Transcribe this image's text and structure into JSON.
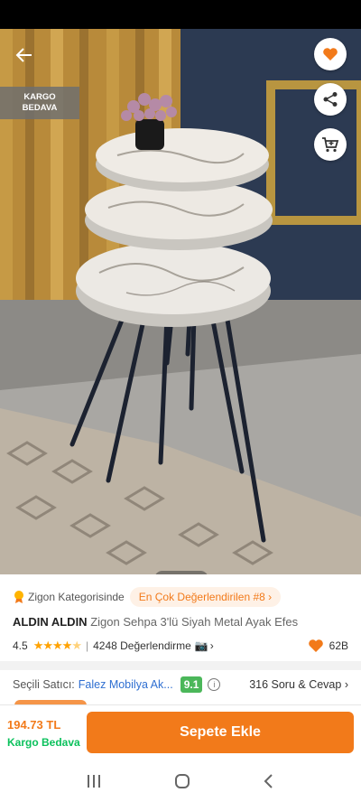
{
  "badge": {
    "line1": "KARGO",
    "line2": "BEDAVA"
  },
  "carousel": {
    "total": 3,
    "active": 0
  },
  "category": {
    "label": "Zigon Kategorisinde",
    "pill": "En Çok Değerlendirilen #8"
  },
  "product": {
    "brand": "ALDIN ALDIN",
    "name": "Zigon Sehpa 3'lü Siyah Metal Ayak Efes"
  },
  "rating": {
    "value": "4.5",
    "stars": 4.5,
    "reviews": "4248 Değerlendirme",
    "favorites": "62B"
  },
  "seller": {
    "label": "Seçili Satıcı:",
    "name": "Falez Mobilya Ak...",
    "score": "9.1",
    "qa": "316 Soru & Cevap"
  },
  "footer": {
    "price": "194.73 TL",
    "shipping": "Kargo Bedava",
    "add_to_cart": "Sepete Ekle"
  },
  "colors": {
    "accent": "#f27a1a",
    "shipping_green": "#0bc15c",
    "score_green": "#4bb75a",
    "link_blue": "#2f6fd1"
  }
}
